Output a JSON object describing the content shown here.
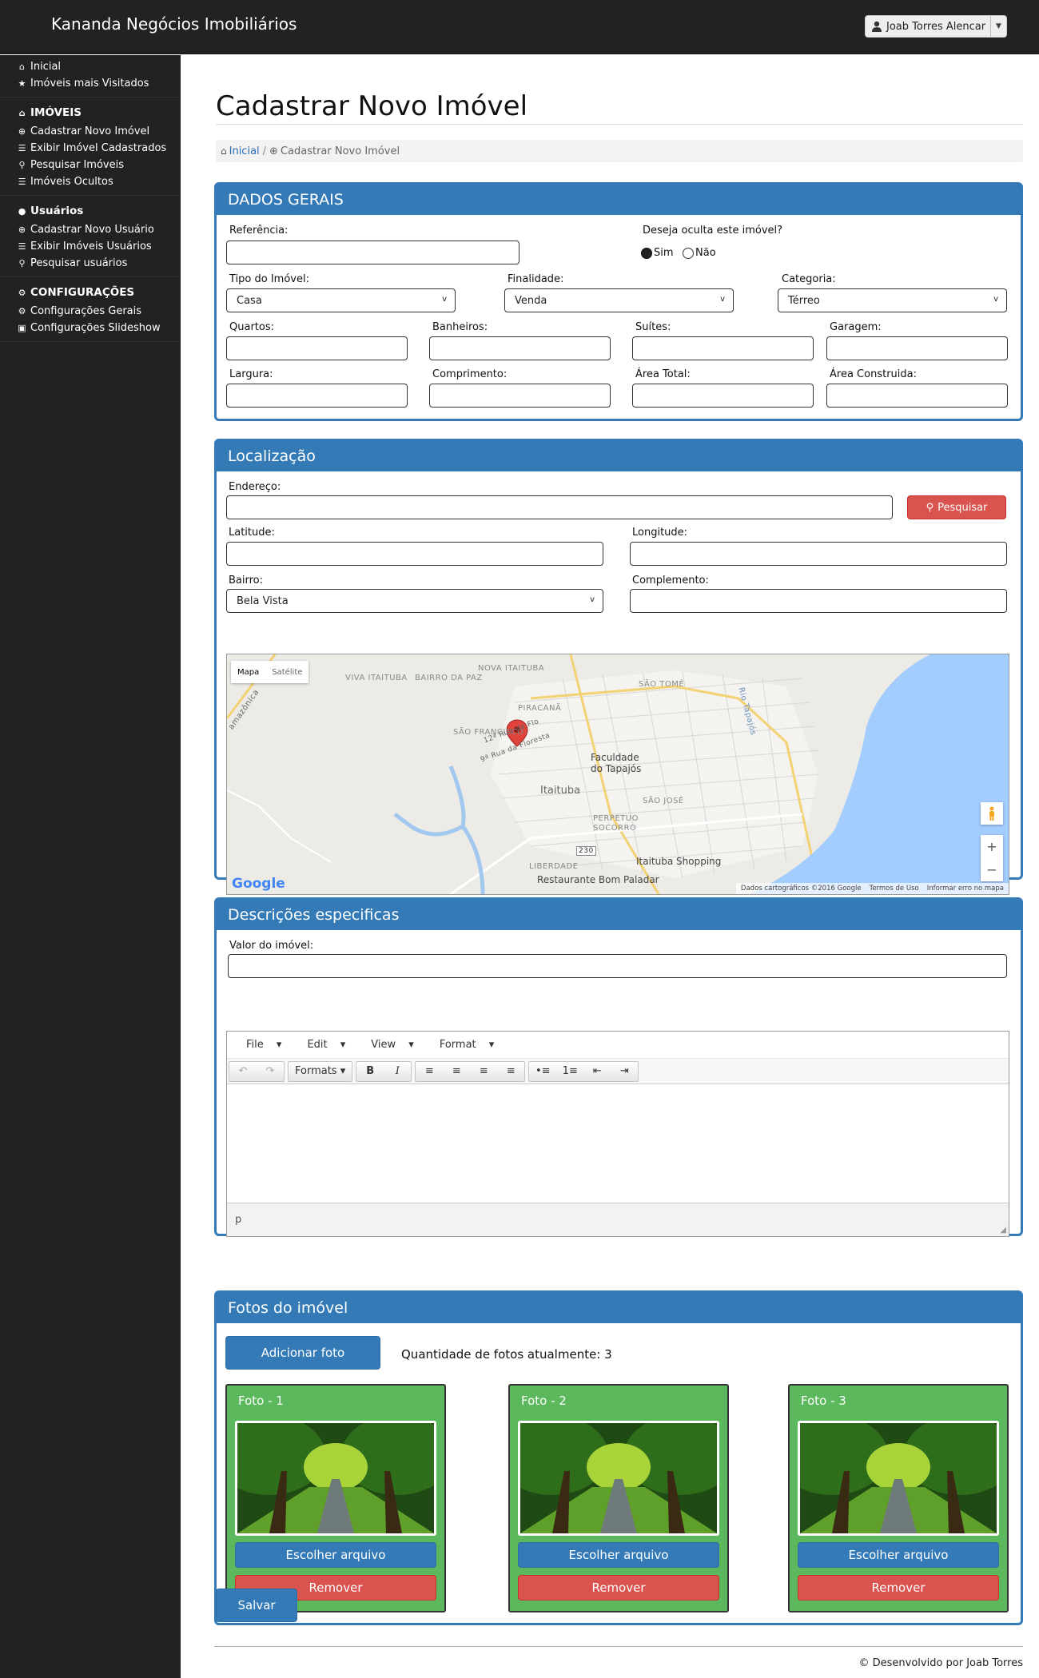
{
  "app": {
    "brand": "Kananda Negócios Imobiliários",
    "user": "Joab Torres Alencar"
  },
  "sidebar": {
    "groups": [
      {
        "items": [
          {
            "icon": "home-icon",
            "label": "Inicial"
          },
          {
            "icon": "star-icon",
            "label": "Imóveis mais Visitados"
          }
        ]
      },
      {
        "head": "IMÓVEIS",
        "items": [
          {
            "icon": "plus-circle-icon",
            "label": "Cadastrar Novo Imóvel"
          },
          {
            "icon": "list-icon",
            "label": "Exibir Imóvel Cadastrados"
          },
          {
            "icon": "search-icon",
            "label": "Pesquisar Imóveis"
          },
          {
            "icon": "list-icon",
            "label": "Imóveis Ocultos"
          }
        ]
      },
      {
        "head": "Usuários",
        "items": [
          {
            "icon": "plus-circle-icon",
            "label": "Cadastrar Novo Usuário"
          },
          {
            "icon": "list-icon",
            "label": "Exibir Imóveis Usuários"
          },
          {
            "icon": "search-icon",
            "label": "Pesquisar usuários"
          }
        ]
      },
      {
        "head": "CONFIGURAÇÕES",
        "items": [
          {
            "icon": "gears-icon",
            "label": "Configurações Gerais"
          },
          {
            "icon": "image-icon",
            "label": "Configurações Slideshow"
          }
        ]
      }
    ]
  },
  "page": {
    "title": "Cadastrar Novo Imóvel"
  },
  "breadcrumb": {
    "home": "Inicial",
    "separator": "/",
    "current": "Cadastrar Novo Imóvel"
  },
  "dados_gerais": {
    "title": "DADOS GERAIS",
    "referencia_label": "Referência:",
    "ocultar_label": "Deseja oculta este imóvel?",
    "sim": "Sim",
    "nao": "Não",
    "tipo_label": "Tipo do Imóvel:",
    "tipo_value": "Casa",
    "finalidade_label": "Finalidade:",
    "finalidade_value": "Venda",
    "categoria_label": "Categoria:",
    "categoria_value": "Térreo",
    "quartos_label": "Quartos:",
    "banheiros_label": "Banheiros:",
    "suites_label": "Suítes:",
    "garagem_label": "Garagem:",
    "largura_label": "Largura:",
    "comprimento_label": "Comprimento:",
    "area_total_label": "Área Total:",
    "area_construida_label": "Área Construida:"
  },
  "localizacao": {
    "title": "Localização",
    "endereco_label": "Endereço:",
    "pesquisar": "Pesquisar",
    "latitude_label": "Latitude:",
    "longitude_label": "Longitude:",
    "bairro_label": "Bairro:",
    "bairro_value": "Bela Vista",
    "complemento_label": "Complemento:",
    "map": {
      "type_map": "Mapa",
      "type_satellite": "Satélite",
      "labels": {
        "viva_itaituba": "VIVA ITAITUBA",
        "bairro_da_paz": "BAIRRO DA PAZ",
        "nova_itaituba": "NOVA ITAITUBA",
        "sao_tome": "SÃO TOMÉ",
        "piracana": "PIRACANÃ",
        "sao_francisco": "SÃO FRANCISCO",
        "faculdade": "Faculdade",
        "faculdade2": "do Tapajós",
        "itaituba": "Itaituba",
        "sao_jose": "SÃO JOSÉ",
        "perpetuo": "PERPETUO",
        "socorro": "SOCORRO",
        "liberdade": "LIBERDADE",
        "shopping": "Itaituba Shopping",
        "restaurante": "Restaurante Bom Paladar",
        "rio": "Rio Tapajós",
        "amazonica": "amazônica",
        "road": "230",
        "rua12": "12ª Rua da Flo",
        "rua9": "9ª Rua da Floresta"
      },
      "google": "Google",
      "footer": [
        "Dados cartográficos ©2016 Google",
        "Termos de Uso",
        "Informar erro no mapa"
      ]
    }
  },
  "descricoes": {
    "title": "Descrições especificas",
    "valor_label": "Valor do imóvel:",
    "menus": [
      "File",
      "Edit",
      "View",
      "Format"
    ],
    "formats": "Formats",
    "status": "p"
  },
  "fotos": {
    "title": "Fotos do imóvel",
    "add": "Adicionar foto",
    "count_text": "Quantidade de fotos atualmente: 3",
    "cards": [
      {
        "title": "Foto - 1",
        "choose": "Escolher arquivo",
        "remove": "Remover"
      },
      {
        "title": "Foto - 2",
        "choose": "Escolher arquivo",
        "remove": "Remover"
      },
      {
        "title": "Foto - 3",
        "choose": "Escolher arquivo",
        "remove": "Remover"
      }
    ]
  },
  "actions": {
    "save": "Salvar"
  },
  "footer": {
    "text": "© Desenvolvido por Joab Torres"
  },
  "colors": {
    "primary": "#337ab7",
    "danger": "#d9534f",
    "success": "#5cb85c",
    "sidebar": "#222222"
  }
}
